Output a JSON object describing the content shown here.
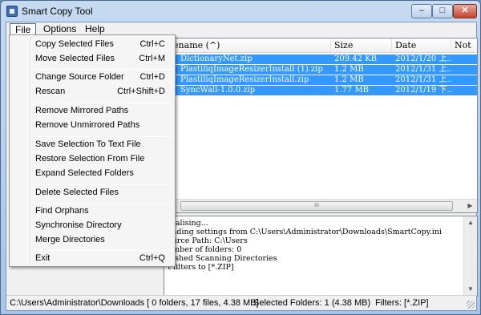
{
  "window": {
    "title": "Smart Copy Tool",
    "min_glyph": "–",
    "max_glyph": "□",
    "close_glyph": "✕"
  },
  "menubar": {
    "items": [
      {
        "label": "File"
      },
      {
        "label": "Options"
      },
      {
        "label": "Help"
      }
    ]
  },
  "file_menu": {
    "items": [
      {
        "label": "Copy Selected Files",
        "shortcut": "Ctrl+C"
      },
      {
        "label": "Move Selected Files",
        "shortcut": "Ctrl+M"
      },
      {
        "label": "Change Source Folder",
        "shortcut": "Ctrl+D"
      },
      {
        "label": "Rescan",
        "shortcut": "Ctrl+Shift+D"
      },
      {
        "label": "Remove Mirrored Paths",
        "shortcut": ""
      },
      {
        "label": "Remove Unmirrored Paths",
        "shortcut": ""
      },
      {
        "label": "Save Selection To Text File",
        "shortcut": ""
      },
      {
        "label": "Restore Selection From File",
        "shortcut": ""
      },
      {
        "label": "Expand Selected Folders",
        "shortcut": ""
      },
      {
        "label": "Delete Selected Files",
        "shortcut": ""
      },
      {
        "label": "Find Orphans",
        "shortcut": ""
      },
      {
        "label": "Synchronise Directory",
        "shortcut": ""
      },
      {
        "label": "Merge Directories",
        "shortcut": ""
      },
      {
        "label": "Exit",
        "shortcut": "Ctrl+Q"
      }
    ]
  },
  "file_grid": {
    "columns": [
      {
        "label": "ilename (^)"
      },
      {
        "label": "Size"
      },
      {
        "label": "Date"
      },
      {
        "label": "Not"
      }
    ],
    "rows": [
      {
        "name": "DictionaryNet.zip",
        "size": "209.42 KB",
        "date": "2012/1/20 上..."
      },
      {
        "name": "PlastiliqImageResizerInstall (1).zip",
        "size": "1.2 MB",
        "date": "2012/1/31 上..."
      },
      {
        "name": "PlastiliqImageResizerInstall.zip",
        "size": "1.2 MB",
        "date": "2012/1/31 上..."
      },
      {
        "name": "SyncWall-1.0.0.zip",
        "size": "1.77 MB",
        "date": "2012/1/19 下..."
      }
    ],
    "scroll_grip": "III"
  },
  "log": {
    "lines": [
      "itialising...",
      "oading settings from C:\\Users\\Administrator\\Downloads\\SmartCopy.ini",
      "ource Path: C:\\Users",
      "umber of folders: 0",
      "nished Scanning Directories",
      "t filters to [*.ZIP]"
    ]
  },
  "statusbar": {
    "path_info": "C:\\Users\\Administrator\\Downloads [ 0 folders, 17 files, 4.38 MB]",
    "selected": "Selected Folders: 1 (4.38 MB)",
    "filters": "Filters: [*.ZIP]"
  },
  "colors": {
    "selection": "#3399ff",
    "titlebar": "#b9d1ea",
    "close": "#c4432c"
  }
}
